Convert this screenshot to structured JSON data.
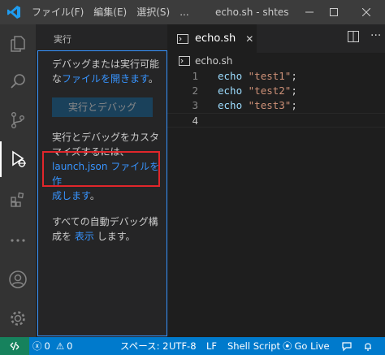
{
  "titlebar": {
    "menus": [
      "ファイル(F)",
      "編集(E)",
      "選択(S)",
      "..."
    ],
    "title": "echo.sh - shtes"
  },
  "sidebar": {
    "title": "実行",
    "intro_text": "デバッグまたは実行可能",
    "intro_prefix": "な",
    "open_file_link": "ファイルを開きます",
    "intro_suffix": "。",
    "run_button": "実行とデバッグ",
    "customize_text": "実行とデバッグをカスタマイズするには、",
    "launch_link_1": "launch.json ファイルを作",
    "launch_link_2": "成します",
    "launch_suffix": "。",
    "auto_debug_text": "すべての自動デバッグ構",
    "auto_debug_prefix": "成を",
    "show_link": "表示",
    "auto_debug_suffix": "します。"
  },
  "tabs": [
    {
      "label": "echo.sh",
      "active": true
    }
  ],
  "breadcrumb": {
    "file": "echo.sh"
  },
  "editor": {
    "lines": [
      {
        "num": "1",
        "cmd": "echo",
        "str": "\"test1\"",
        "end": ";"
      },
      {
        "num": "2",
        "cmd": "echo",
        "str": "\"test2\"",
        "end": ";"
      },
      {
        "num": "3",
        "cmd": "echo",
        "str": "\"test3\"",
        "end": ";"
      },
      {
        "num": "4",
        "cmd": "",
        "str": "",
        "end": ""
      }
    ]
  },
  "statusbar": {
    "errors": "0",
    "warnings": "0",
    "spaces": "スペース: 2",
    "encoding": "UTF-8",
    "eol": "LF",
    "language": "Shell Script",
    "golive": "Go Live"
  },
  "colors": {
    "accent": "#007acc",
    "link": "#3794ff",
    "highlight": "#e0262b"
  }
}
